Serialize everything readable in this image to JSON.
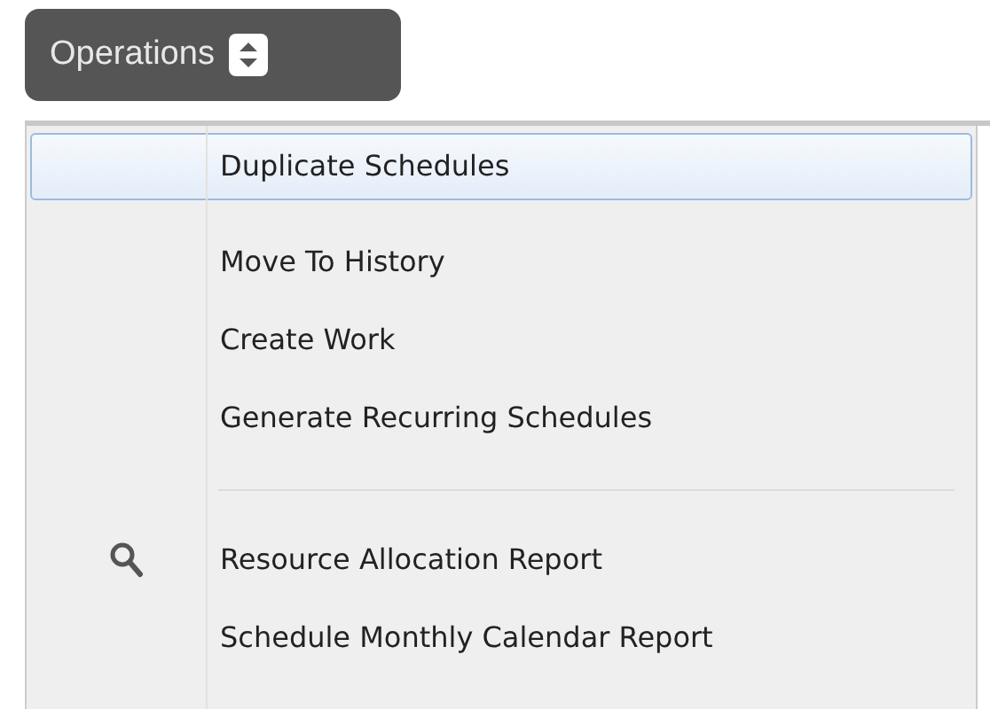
{
  "button": {
    "label": "Operations"
  },
  "menu": [
    {
      "kind": "item",
      "label": "Duplicate Schedules",
      "selected": true
    },
    {
      "kind": "item",
      "label": "Move To History",
      "selected": false
    },
    {
      "kind": "item",
      "label": "Create Work",
      "selected": false
    },
    {
      "kind": "item",
      "label": "Generate Recurring Schedules",
      "selected": false
    },
    {
      "kind": "separator"
    },
    {
      "kind": "item",
      "label": "Resource Allocation Report",
      "selected": false,
      "has_icon": true
    },
    {
      "kind": "item",
      "label": "Schedule Monthly Calendar Report",
      "selected": false
    }
  ]
}
